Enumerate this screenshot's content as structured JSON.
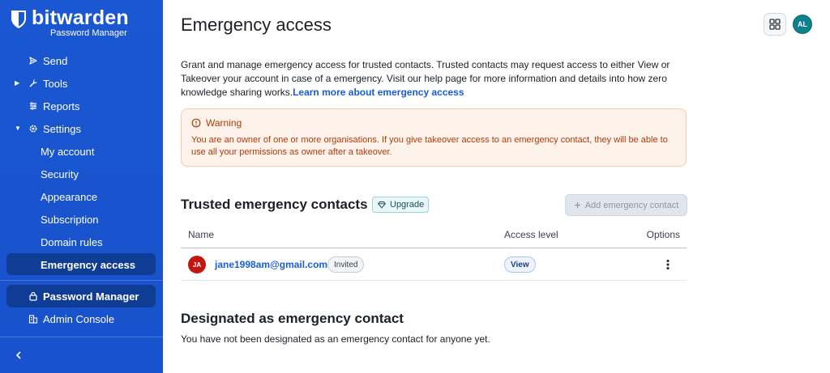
{
  "brand": {
    "name": "bitwarden",
    "product": "Password Manager"
  },
  "sidebar": {
    "items": [
      {
        "label": "Send",
        "icon": "send-icon"
      },
      {
        "label": "Tools",
        "icon": "wrench-icon",
        "caret": "collapsed"
      },
      {
        "label": "Reports",
        "icon": "reports-icon"
      },
      {
        "label": "Settings",
        "icon": "gear-icon",
        "caret": "expanded"
      }
    ],
    "settings_children": [
      {
        "label": "My account"
      },
      {
        "label": "Security"
      },
      {
        "label": "Appearance"
      },
      {
        "label": "Subscription"
      },
      {
        "label": "Domain rules"
      },
      {
        "label": "Emergency access",
        "active": true
      }
    ],
    "products": [
      {
        "label": "Password Manager",
        "icon": "lock-icon",
        "selected": true
      },
      {
        "label": "Admin Console",
        "icon": "business-icon"
      }
    ]
  },
  "header": {
    "title": "Emergency access",
    "user_initials": "AL"
  },
  "description": {
    "text": "Grant and manage emergency access for trusted contacts. Trusted contacts may request access to either View or Takeover your account in case of a emergency. Visit our help page for more information and details into how zero knowledge sharing works.",
    "link": "Learn more about emergency access"
  },
  "warning": {
    "title": "Warning",
    "body": "You are an owner of one or more organisations. If you give takeover access to an emergency contact, they will be able to use all your permissions as owner after a takeover."
  },
  "trusted": {
    "title": "Trusted emergency contacts",
    "upgrade_label": "Upgrade",
    "add_button": "Add emergency contact",
    "columns": {
      "name": "Name",
      "access": "Access level",
      "options": "Options"
    },
    "rows": [
      {
        "initials": "JA",
        "email": "jane1998am@gmail.com",
        "status": "Invited",
        "access": "View"
      }
    ]
  },
  "designated": {
    "title": "Designated as emergency contact",
    "empty": "You have not been designated as an emergency contact for anyone yet."
  },
  "colors": {
    "sidebar": "#175ddc",
    "active_nav": "#0f3d96",
    "link": "#175ddc",
    "warning_text": "#b33a0b",
    "contact_avatar": "#c2160e",
    "user_avatar": "#0e7f8c"
  }
}
